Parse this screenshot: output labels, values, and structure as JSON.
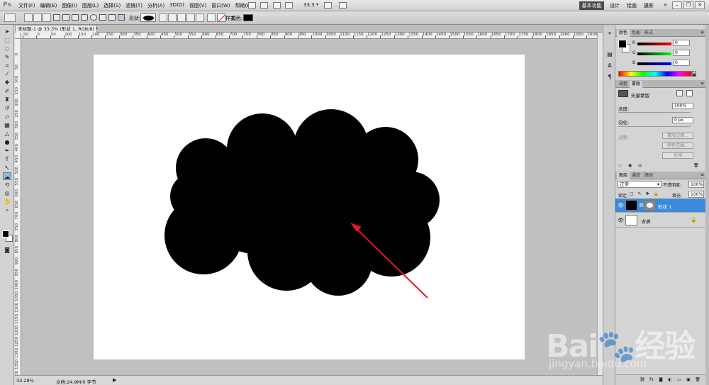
{
  "app": {
    "logo": "Ps"
  },
  "menubar": {
    "items": [
      "文件(F)",
      "编辑(E)",
      "图像(I)",
      "图层(L)",
      "选择(S)",
      "滤镜(T)",
      "分析(A)",
      "3D(D)",
      "视图(V)",
      "窗口(W)",
      "帮助(H)"
    ],
    "zoom": "33.3",
    "workspaces": [
      "基本功能",
      "设计",
      "绘画",
      "摄影"
    ],
    "more": "»"
  },
  "optionsbar": {
    "shape_label": "形状:",
    "style_label": "样式:",
    "color_label": "颜色:",
    "fill_color": "#000000",
    "stroke_indicator_color": "#e00000"
  },
  "document": {
    "tab_title": "未标题-1 @ 33.3% (形状 1, RGB/8) *",
    "ruler_top_labels": [
      "50",
      "0",
      "50",
      "100",
      "150",
      "200",
      "250",
      "300",
      "350",
      "400",
      "450",
      "500",
      "550",
      "600",
      "650",
      "700",
      "750",
      "800",
      "850",
      "900",
      "950",
      "1000",
      "1050",
      "1100",
      "1150",
      "1200",
      "1250",
      "1300",
      "1350",
      "1400",
      "1450",
      "1500",
      "1550",
      "1600",
      "1650",
      "1700",
      "1750",
      "1800",
      "1850",
      "1900",
      "1950",
      "2000",
      "2050"
    ],
    "ruler_left_labels": [
      "0",
      "50",
      "100",
      "150",
      "200",
      "250",
      "300",
      "350",
      "400",
      "450",
      "500",
      "550",
      "600",
      "650",
      "700",
      "750",
      "800",
      "850",
      "900",
      "950",
      "1000",
      "1050",
      "1100",
      "1150",
      "1200",
      "1250",
      "1300",
      "1350",
      "1400",
      "1450",
      "1500"
    ],
    "shape_color": "#000000",
    "arrow_color": "#e8161d"
  },
  "status": {
    "zoom": "33.28%",
    "doc_size": "文档:24.9M/0 字节",
    "arrow": "▶"
  },
  "panels": {
    "color": {
      "tabs": [
        "颜色",
        "色板",
        "样式"
      ],
      "r_label": "R",
      "g_label": "G",
      "b_label": "B",
      "r_value": "0",
      "g_value": "0",
      "b_value": "0"
    },
    "masks": {
      "tabs": [
        "调整",
        "蒙版"
      ],
      "title": "矢量蒙版",
      "density_label": "浓度:",
      "density_value": "100%",
      "feather_label": "羽化:",
      "feather_value": "0 px",
      "refine_label": "调整:",
      "btn_edge": "蒙版边缘...",
      "btn_color_range": "颜色范围...",
      "btn_invert": "反相"
    },
    "layers": {
      "tabs": [
        "图层",
        "通道",
        "路径"
      ],
      "blend_mode": "正常",
      "opacity_label": "不透明度:",
      "opacity_value": "100%",
      "lock_label": "锁定:",
      "fill_label": "填充:",
      "fill_value": "100%",
      "items": [
        {
          "name": "形状 1",
          "selected": true
        },
        {
          "name": "背景",
          "selected": false
        }
      ]
    }
  },
  "watermark": {
    "text": "Bai🐾经验",
    "url": "jingyan.baidu.com"
  }
}
